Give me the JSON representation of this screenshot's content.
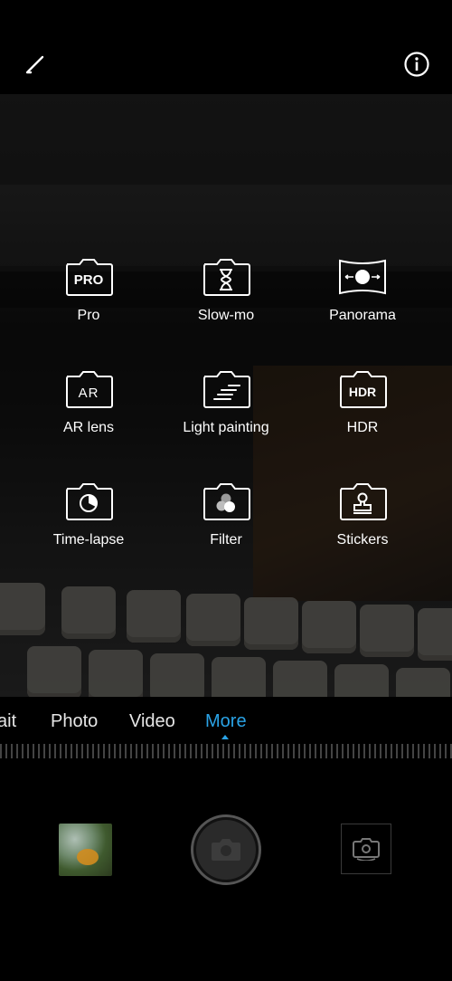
{
  "topbar": {
    "edit_icon": "pencil-icon",
    "info_icon": "info-icon"
  },
  "modes_grid": [
    {
      "label": "Pro",
      "icon": "pro-camera-icon",
      "icon_text": "PRO"
    },
    {
      "label": "Slow-mo",
      "icon": "hourglass-camera-icon"
    },
    {
      "label": "Panorama",
      "icon": "panorama-camera-icon"
    },
    {
      "label": "AR lens",
      "icon": "ar-camera-icon",
      "icon_text": "AR"
    },
    {
      "label": "Light painting",
      "icon": "light-painting-camera-icon"
    },
    {
      "label": "HDR",
      "icon": "hdr-camera-icon",
      "icon_text": "HDR"
    },
    {
      "label": "Time-lapse",
      "icon": "time-lapse-camera-icon"
    },
    {
      "label": "Filter",
      "icon": "filter-camera-icon"
    },
    {
      "label": "Stickers",
      "icon": "stickers-camera-icon"
    }
  ],
  "mode_bar": {
    "items": [
      {
        "label": "ait"
      },
      {
        "label": "Photo"
      },
      {
        "label": "Video"
      },
      {
        "label": "More"
      }
    ],
    "active": "More",
    "active_color": "#2aa3e6"
  },
  "bottom": {
    "gallery_icon": "gallery-thumbnail",
    "shutter_icon": "camera-icon",
    "switch_icon": "switch-camera-icon"
  }
}
